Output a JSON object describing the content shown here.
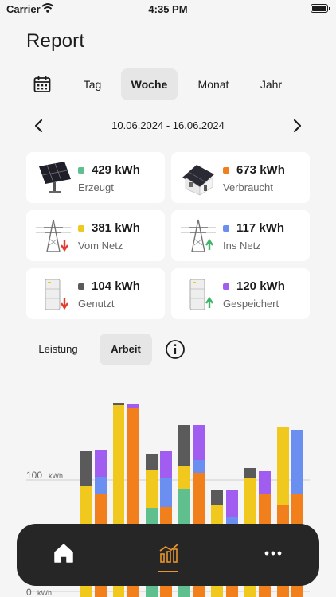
{
  "status": {
    "carrier": "Carrier",
    "time": "4:35 PM"
  },
  "title": "Report",
  "tabs": {
    "day": "Tag",
    "week": "Woche",
    "month": "Monat",
    "year": "Jahr",
    "active": "week"
  },
  "date_range": "10.06.2024 - 16.06.2024",
  "cards": {
    "produced": {
      "value": "429 kWh",
      "label": "Erzeugt",
      "color": "#5fbf8f"
    },
    "consumed": {
      "value": "673 kWh",
      "label": "Verbraucht",
      "color": "#f07f1c"
    },
    "from_grid": {
      "value": "381 kWh",
      "label": "Vom Netz",
      "color": "#f0c81e"
    },
    "to_grid": {
      "value": "117 kWh",
      "label": "Ins Netz",
      "color": "#6a8ff0"
    },
    "used": {
      "value": "104 kWh",
      "label": "Genutzt",
      "color": "#5a5a5a"
    },
    "stored": {
      "value": "120 kWh",
      "label": "Gespeichert",
      "color": "#a15cf0"
    }
  },
  "mode_tabs": {
    "power": "Leistung",
    "energy": "Arbeit",
    "active": "energy"
  },
  "chart_data": {
    "type": "bar",
    "unit": "kWh",
    "y_ticks": [
      {
        "value": 100,
        "label": "100",
        "unit": "kWh"
      },
      {
        "value": 0,
        "label": "0",
        "unit": "kWh"
      }
    ],
    "ylim": [
      0,
      240
    ],
    "colors": {
      "consumption": "#f07f1c",
      "grid": "#f0c81e",
      "battery_out": "#5a5a5a",
      "feed_in": "#6a8ff0",
      "battery_in": "#a15cf0",
      "solar": "#5fbf8f"
    }
  },
  "bottom_nav": {
    "home": "home-icon",
    "report": "chart-icon",
    "more": "more-icon"
  }
}
